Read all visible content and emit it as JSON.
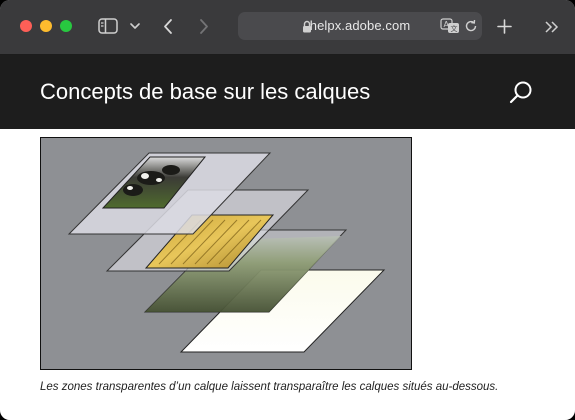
{
  "browser": {
    "url": "helpx.adobe.com"
  },
  "page": {
    "title": "Concepts de base sur les calques",
    "caption": "Les zones transparentes d’un calque laissent transparaître les calques situés au-dessous."
  },
  "icons": [
    "sidebar-icon",
    "chevron-down-icon",
    "back-icon",
    "forward-icon",
    "lock-icon",
    "translate-icon",
    "reload-icon",
    "new-tab-icon",
    "more-icon",
    "search-icon"
  ]
}
